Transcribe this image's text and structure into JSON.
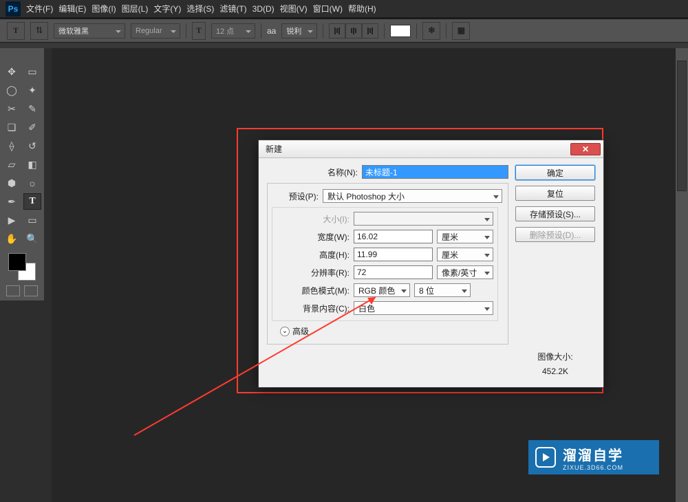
{
  "app": {
    "logo": "Ps"
  },
  "menu": [
    "文件(F)",
    "编辑(E)",
    "图像(I)",
    "图层(L)",
    "文字(Y)",
    "选择(S)",
    "滤镜(T)",
    "3D(D)",
    "视图(V)",
    "窗口(W)",
    "帮助(H)"
  ],
  "options_bar": {
    "font_family": "微软雅黑",
    "font_style": "Regular",
    "font_size": "12 点",
    "aa_label": "aa",
    "aa_mode": "锐利",
    "color_swatch": "#ffffff"
  },
  "dialog": {
    "title": "新建",
    "labels": {
      "name": "名称(N):",
      "preset": "预设(P):",
      "size": "大小(I):",
      "width": "宽度(W):",
      "height": "高度(H):",
      "resolution": "分辨率(R):",
      "color_mode": "颜色模式(M):",
      "bg_content": "背景内容(C):",
      "advanced": "高级"
    },
    "values": {
      "name": "未标题-1",
      "preset": "默认 Photoshop 大小",
      "size": "",
      "width": "16.02",
      "width_unit": "厘米",
      "height": "11.99",
      "height_unit": "厘米",
      "resolution": "72",
      "resolution_unit": "像素/英寸",
      "color_mode": "RGB 颜色",
      "bit_depth": "8 位",
      "bg_content": "白色"
    },
    "buttons": {
      "ok": "确定",
      "reset": "复位",
      "save_preset": "存储预设(S)...",
      "delete_preset": "删除预设(D)..."
    },
    "image_size_label": "图像大小:",
    "image_size_value": "452.2K"
  },
  "watermark": {
    "title": "溜溜自学",
    "subtitle": "ZIXUE.3D66.COM"
  }
}
